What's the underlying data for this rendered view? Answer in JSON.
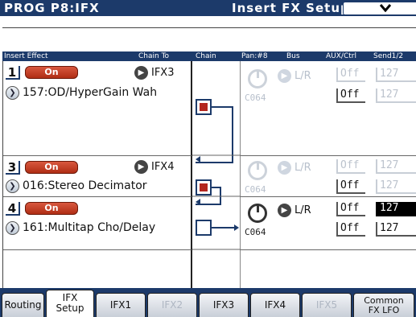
{
  "title": {
    "mode": "PROG P8:IFX",
    "page": "Insert FX Setup",
    "menu_icon": "chevron-down-icon"
  },
  "columns": {
    "insert_effect": "Insert Effect",
    "chain_to": "Chain To",
    "chain": "Chain",
    "pan": "Pan:#8",
    "bus": "Bus",
    "aux_ctrl": "AUX/Ctrl",
    "send": "Send1/2"
  },
  "slots": [
    {
      "num": "1",
      "on": "On",
      "chain_to": "IFX3",
      "effect": "157:OD/HyperGain Wah",
      "chain_on": true,
      "pan": "C064",
      "bus": "L/R",
      "aux": "Off",
      "ctrl": "Off",
      "send1": "127",
      "send2": "127",
      "enabled": false
    },
    {
      "num": "3",
      "on": "On",
      "chain_to": "IFX4",
      "effect": "016:Stereo Decimator",
      "chain_on": true,
      "pan": "C064",
      "bus": "L/R",
      "aux": "Off",
      "ctrl": "Off",
      "send1": "127",
      "send2": "127",
      "enabled": false
    },
    {
      "num": "4",
      "on": "On",
      "effect": "161:Multitap Cho/Delay",
      "chain_on": false,
      "pan": "C064",
      "bus": "L/R",
      "aux": "Off",
      "ctrl": "Off",
      "send1": "127",
      "send2": "127",
      "enabled": true
    }
  ],
  "tabs": [
    {
      "label": "Routing",
      "state": "normal"
    },
    {
      "label": "IFX\nSetup",
      "line1": "IFX",
      "line2": "Setup",
      "state": "active"
    },
    {
      "label": "IFX1",
      "state": "normal"
    },
    {
      "label": "IFX2",
      "state": "disabled"
    },
    {
      "label": "IFX3",
      "state": "normal"
    },
    {
      "label": "IFX4",
      "state": "normal"
    },
    {
      "label": "IFX5",
      "state": "disabled"
    },
    {
      "label": "Common FX LFO",
      "line1": "Common",
      "line2": "FX LFO",
      "state": "normal"
    }
  ],
  "colors": {
    "header": "#1c3a6a",
    "on_button": "#c0391f",
    "chain_fill": "#b3261e"
  }
}
